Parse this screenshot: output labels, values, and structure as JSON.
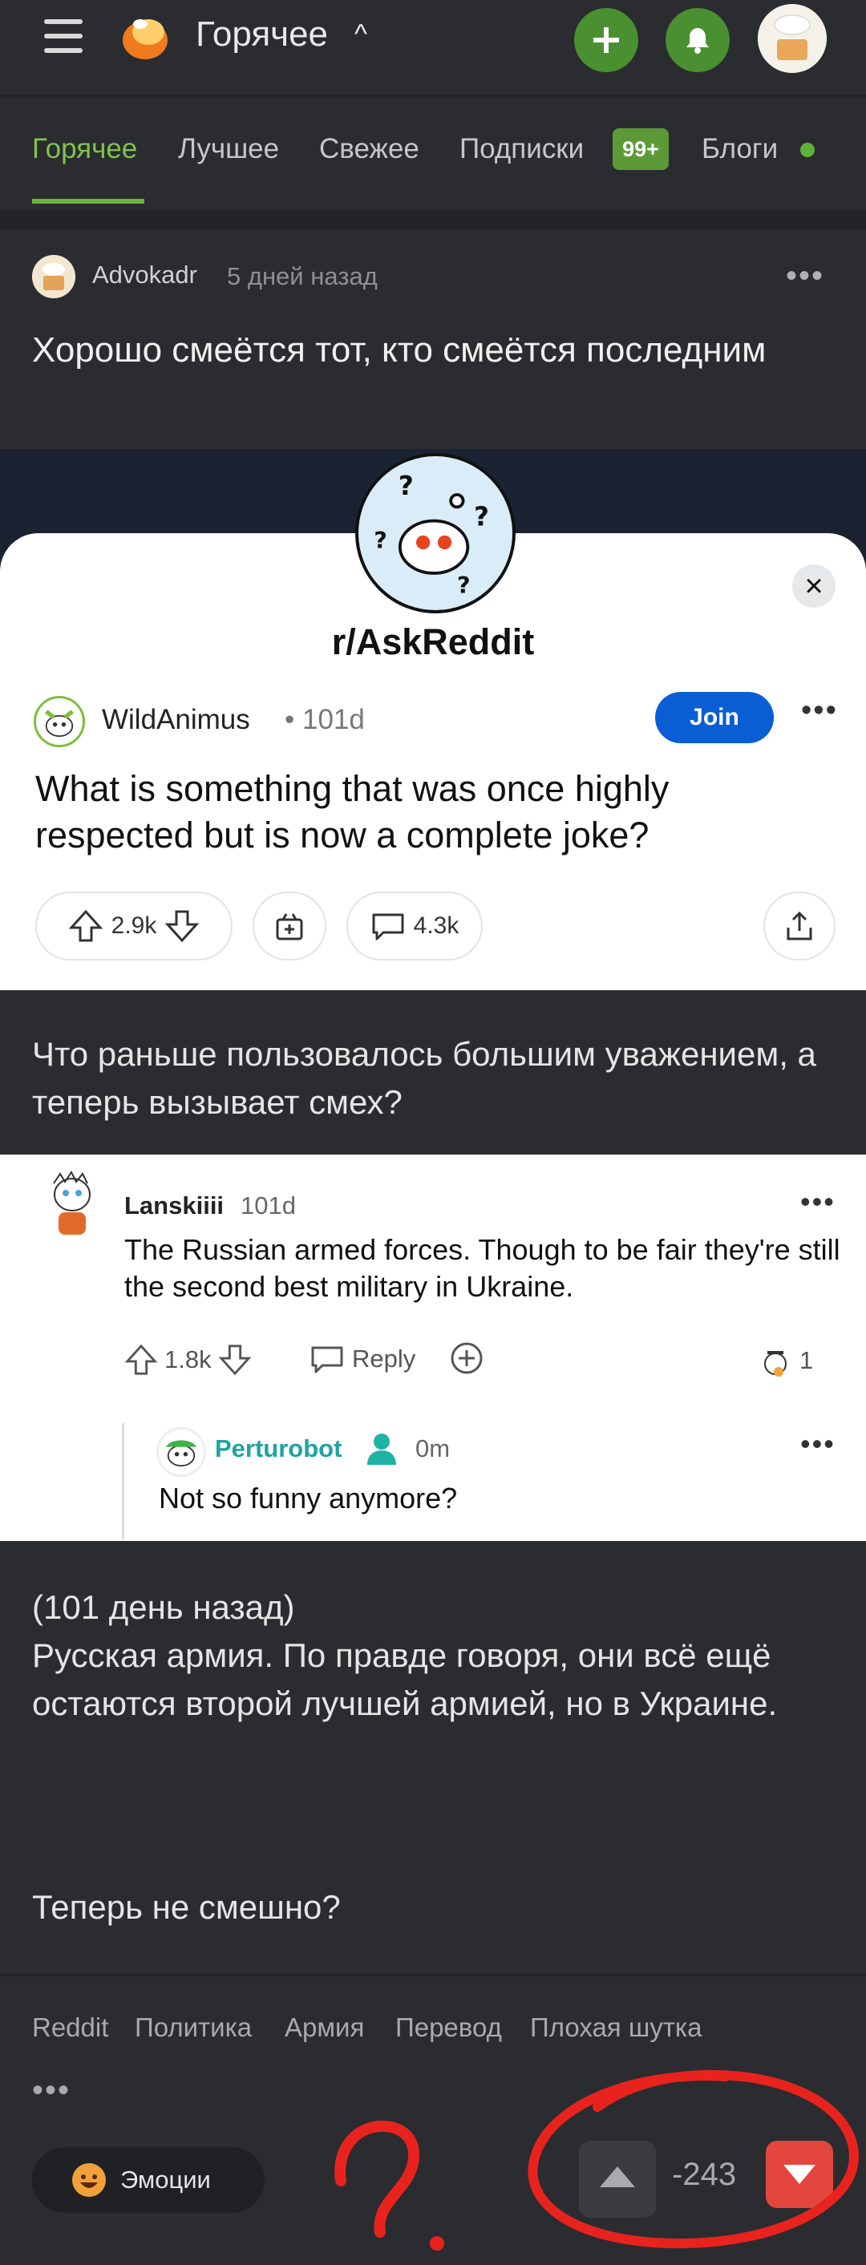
{
  "topbar": {
    "title": "Горячее"
  },
  "tabs": [
    {
      "label": "Горячее",
      "active": true
    },
    {
      "label": "Лучшее"
    },
    {
      "label": "Свежее"
    },
    {
      "label": "Подписки"
    },
    {
      "label": "Блоги"
    }
  ],
  "subs_badge": "99+",
  "post": {
    "author": "Advokadr",
    "time": "5 дней назад",
    "title": "Хорошо смеётся тот, кто смеётся последним",
    "screenshot": {
      "subreddit": "r/AskReddit",
      "user": "WildAnimus",
      "age": "• 101d",
      "join": "Join",
      "question": "What is something that was once highly respected but is now a complete joke?",
      "votes": "2.9k",
      "comments": "4.3k"
    },
    "translation": "Что раньше пользовалось большим уважением, а теперь вызывает смех?",
    "comment": {
      "user": "Lanskiiii",
      "age": "101d",
      "text": "The Russian armed forces. Though to be fair they're still the second best military in Ukraine.",
      "votes": "1.8k",
      "reply": "Reply",
      "awards": "1"
    },
    "reply": {
      "user": "Perturobot",
      "age": "0m",
      "text": "Not so funny anymore?"
    },
    "body_lines": [
      "(101 день назад)",
      "Русская армия. По правде говоря, они всё ещё остаются второй лучшей армией, но в Украине."
    ],
    "last_line": "Теперь не смешно?",
    "tags": [
      "Reddit",
      "Политика",
      "Армия",
      "Перевод",
      "Плохая шутка"
    ],
    "more": "•••",
    "emotions": "Эмоции",
    "score": "-243"
  },
  "colors": {
    "accent": "#6cb33b",
    "down": "#e2463f",
    "annotation": "#e8231e"
  }
}
